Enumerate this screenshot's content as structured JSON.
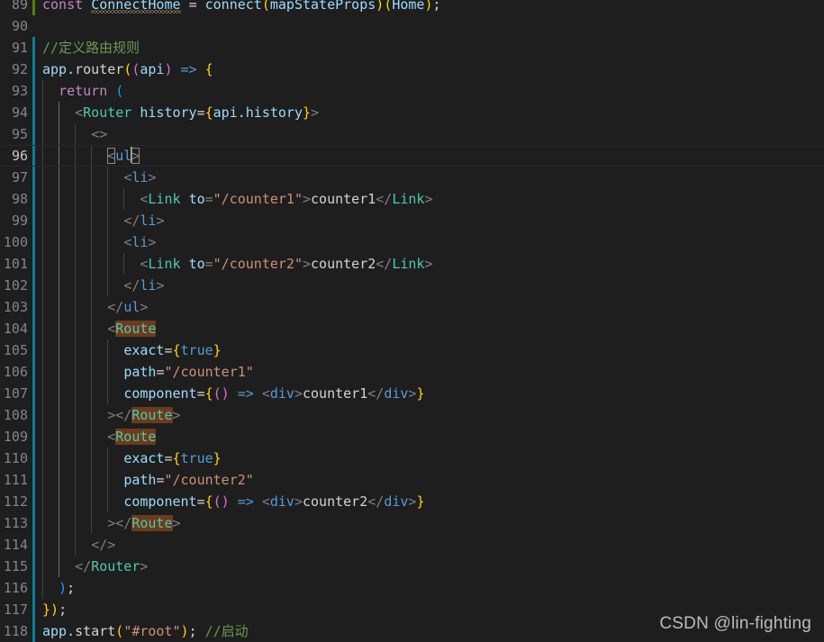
{
  "editor": {
    "theme": "dark-plus",
    "language": "javascript",
    "colors": {
      "background": "#1e1e1e",
      "foreground": "#d4d4d4",
      "line_number": "#858585",
      "line_number_active": "#c6c6c6",
      "comment": "#6a9955",
      "string": "#ce9178",
      "variable": "#9cdcfe",
      "component": "#4ec9b0",
      "tag": "#569cd6",
      "keyword": "#c586c0",
      "bracket_yellow": "#ffd700",
      "bracket_magenta": "#da70d6",
      "bracket_blue": "#179fff",
      "word_highlight": "#6c3b1c",
      "git_modified": "#0c7d9d",
      "git_added": "#587c0c",
      "indent_guide": "#404040",
      "indent_guide_active": "#707070",
      "caret": "#aeafad"
    },
    "active_line": 96,
    "first_visible_line": 89,
    "last_visible_line": 118
  },
  "watermark": {
    "text": "CSDN @lin-fighting"
  },
  "lines": [
    {
      "number": "89",
      "git": "add",
      "guides": 0,
      "clipped_top": true,
      "tokens": [
        {
          "text": "const ",
          "cls": "t-kw"
        },
        {
          "text": "ConnectHome",
          "cls": "t-var squig"
        },
        {
          "text": " ",
          "cls": "t-plain"
        },
        {
          "text": "=",
          "cls": "t-op"
        },
        {
          "text": " ",
          "cls": "t-plain"
        },
        {
          "text": "connect",
          "cls": "t-var"
        },
        {
          "text": "(",
          "cls": "t-punc1"
        },
        {
          "text": "mapStateProps",
          "cls": "t-var"
        },
        {
          "text": ")",
          "cls": "t-punc1"
        },
        {
          "text": "(",
          "cls": "t-punc1"
        },
        {
          "text": "Home",
          "cls": "t-var"
        },
        {
          "text": ")",
          "cls": "t-punc1"
        },
        {
          "text": ";",
          "cls": "t-plain"
        }
      ]
    },
    {
      "number": "90",
      "git": "none",
      "guides": 0,
      "tokens": []
    },
    {
      "number": "91",
      "git": "mod",
      "guides": 0,
      "tokens": [
        {
          "text": "//定义路由规则",
          "cls": "t-cmt"
        }
      ]
    },
    {
      "number": "92",
      "git": "mod",
      "guides": 0,
      "tokens": [
        {
          "text": "app",
          "cls": "t-var"
        },
        {
          "text": ".",
          "cls": "t-plain"
        },
        {
          "text": "router",
          "cls": "t-plain"
        },
        {
          "text": "(",
          "cls": "t-punc1"
        },
        {
          "text": "(",
          "cls": "t-punc2"
        },
        {
          "text": "api",
          "cls": "t-var"
        },
        {
          "text": ")",
          "cls": "t-punc2"
        },
        {
          "text": " ",
          "cls": "t-plain"
        },
        {
          "text": "=>",
          "cls": "t-arrow"
        },
        {
          "text": " ",
          "cls": "t-plain"
        },
        {
          "text": "{",
          "cls": "t-punc1"
        }
      ]
    },
    {
      "number": "93",
      "git": "mod",
      "guides": 1,
      "tokens": [
        {
          "text": "  ",
          "cls": "t-plain"
        },
        {
          "text": "return",
          "cls": "t-kw"
        },
        {
          "text": " ",
          "cls": "t-plain"
        },
        {
          "text": "(",
          "cls": "t-punc3"
        }
      ]
    },
    {
      "number": "94",
      "git": "mod",
      "guides": 2,
      "active_guide": 1,
      "tokens": [
        {
          "text": "    ",
          "cls": "t-plain"
        },
        {
          "text": "<",
          "cls": "t-tagbr"
        },
        {
          "text": "Router",
          "cls": "t-comp"
        },
        {
          "text": " ",
          "cls": "t-plain"
        },
        {
          "text": "history",
          "cls": "t-var"
        },
        {
          "text": "=",
          "cls": "t-plain"
        },
        {
          "text": "{",
          "cls": "t-punc1"
        },
        {
          "text": "api",
          "cls": "t-var"
        },
        {
          "text": ".",
          "cls": "t-plain"
        },
        {
          "text": "history",
          "cls": "t-var"
        },
        {
          "text": "}",
          "cls": "t-punc1"
        },
        {
          "text": ">",
          "cls": "t-tagbr"
        }
      ]
    },
    {
      "number": "95",
      "git": "mod",
      "guides": 3,
      "active_guide": 1,
      "tokens": [
        {
          "text": "      ",
          "cls": "t-plain"
        },
        {
          "text": "<>",
          "cls": "t-tagbr"
        }
      ]
    },
    {
      "number": "96",
      "git": "mod",
      "guides": 4,
      "active_guide": 1,
      "current": true,
      "tokens": [
        {
          "text": "        ",
          "cls": "t-plain"
        },
        {
          "text": "<",
          "cls": "t-tagbr bmatch"
        },
        {
          "text": "ul",
          "cls": "t-tag"
        },
        {
          "text": "|CARET|",
          "cls": "caret"
        },
        {
          "text": ">",
          "cls": "t-tagbr bmatch"
        }
      ]
    },
    {
      "number": "97",
      "git": "mod",
      "guides": 5,
      "active_guide": 1,
      "tokens": [
        {
          "text": "          ",
          "cls": "t-plain"
        },
        {
          "text": "<",
          "cls": "t-tagbr"
        },
        {
          "text": "li",
          "cls": "t-tag"
        },
        {
          "text": ">",
          "cls": "t-tagbr"
        }
      ]
    },
    {
      "number": "98",
      "git": "mod",
      "guides": 6,
      "active_guide": 1,
      "tokens": [
        {
          "text": "            ",
          "cls": "t-plain"
        },
        {
          "text": "<",
          "cls": "t-tagbr"
        },
        {
          "text": "Link",
          "cls": "t-comp"
        },
        {
          "text": " ",
          "cls": "t-plain"
        },
        {
          "text": "to",
          "cls": "t-var"
        },
        {
          "text": "=",
          "cls": "t-tagbr"
        },
        {
          "text": "\"/counter1\"",
          "cls": "t-str"
        },
        {
          "text": ">",
          "cls": "t-tagbr"
        },
        {
          "text": "counter1",
          "cls": "t-plain"
        },
        {
          "text": "</",
          "cls": "t-tagbr"
        },
        {
          "text": "Link",
          "cls": "t-comp"
        },
        {
          "text": ">",
          "cls": "t-tagbr"
        }
      ]
    },
    {
      "number": "99",
      "git": "mod",
      "guides": 5,
      "active_guide": 1,
      "tokens": [
        {
          "text": "          ",
          "cls": "t-plain"
        },
        {
          "text": "</",
          "cls": "t-tagbr"
        },
        {
          "text": "li",
          "cls": "t-tag"
        },
        {
          "text": ">",
          "cls": "t-tagbr"
        }
      ]
    },
    {
      "number": "100",
      "git": "mod",
      "guides": 5,
      "active_guide": 1,
      "tokens": [
        {
          "text": "          ",
          "cls": "t-plain"
        },
        {
          "text": "<",
          "cls": "t-tagbr"
        },
        {
          "text": "li",
          "cls": "t-tag"
        },
        {
          "text": ">",
          "cls": "t-tagbr"
        }
      ]
    },
    {
      "number": "101",
      "git": "mod",
      "guides": 6,
      "active_guide": 1,
      "tokens": [
        {
          "text": "            ",
          "cls": "t-plain"
        },
        {
          "text": "<",
          "cls": "t-tagbr"
        },
        {
          "text": "Link",
          "cls": "t-comp"
        },
        {
          "text": " ",
          "cls": "t-plain"
        },
        {
          "text": "to",
          "cls": "t-var"
        },
        {
          "text": "=",
          "cls": "t-tagbr"
        },
        {
          "text": "\"/counter2\"",
          "cls": "t-str"
        },
        {
          "text": ">",
          "cls": "t-tagbr"
        },
        {
          "text": "counter2",
          "cls": "t-plain"
        },
        {
          "text": "</",
          "cls": "t-tagbr"
        },
        {
          "text": "Link",
          "cls": "t-comp"
        },
        {
          "text": ">",
          "cls": "t-tagbr"
        }
      ]
    },
    {
      "number": "102",
      "git": "mod",
      "guides": 5,
      "active_guide": 1,
      "tokens": [
        {
          "text": "          ",
          "cls": "t-plain"
        },
        {
          "text": "</",
          "cls": "t-tagbr"
        },
        {
          "text": "li",
          "cls": "t-tag"
        },
        {
          "text": ">",
          "cls": "t-tagbr"
        }
      ]
    },
    {
      "number": "103",
      "git": "mod",
      "guides": 4,
      "active_guide": 1,
      "tokens": [
        {
          "text": "        ",
          "cls": "t-plain"
        },
        {
          "text": "</",
          "cls": "t-tagbr"
        },
        {
          "text": "ul",
          "cls": "t-tag"
        },
        {
          "text": ">",
          "cls": "t-tagbr"
        }
      ]
    },
    {
      "number": "104",
      "git": "mod",
      "guides": 4,
      "active_guide": 1,
      "tokens": [
        {
          "text": "        ",
          "cls": "t-plain"
        },
        {
          "text": "<",
          "cls": "t-tagbr"
        },
        {
          "text": "Route",
          "cls": "t-comp hl-word"
        }
      ]
    },
    {
      "number": "105",
      "git": "mod",
      "guides": 5,
      "active_guide": 1,
      "tokens": [
        {
          "text": "          ",
          "cls": "t-plain"
        },
        {
          "text": "exact",
          "cls": "t-var"
        },
        {
          "text": "=",
          "cls": "t-plain"
        },
        {
          "text": "{",
          "cls": "t-punc1"
        },
        {
          "text": "true",
          "cls": "t-bool"
        },
        {
          "text": "}",
          "cls": "t-punc1"
        }
      ]
    },
    {
      "number": "106",
      "git": "mod",
      "guides": 5,
      "active_guide": 1,
      "tokens": [
        {
          "text": "          ",
          "cls": "t-plain"
        },
        {
          "text": "path",
          "cls": "t-var"
        },
        {
          "text": "=",
          "cls": "t-plain"
        },
        {
          "text": "\"/counter1\"",
          "cls": "t-str"
        }
      ]
    },
    {
      "number": "107",
      "git": "mod",
      "guides": 5,
      "active_guide": 1,
      "tokens": [
        {
          "text": "          ",
          "cls": "t-plain"
        },
        {
          "text": "component",
          "cls": "t-var"
        },
        {
          "text": "=",
          "cls": "t-plain"
        },
        {
          "text": "{",
          "cls": "t-punc1"
        },
        {
          "text": "()",
          "cls": "t-punc2"
        },
        {
          "text": " ",
          "cls": "t-plain"
        },
        {
          "text": "=>",
          "cls": "t-arrow"
        },
        {
          "text": " ",
          "cls": "t-plain"
        },
        {
          "text": "<",
          "cls": "t-tagbr"
        },
        {
          "text": "div",
          "cls": "t-tag"
        },
        {
          "text": ">",
          "cls": "t-tagbr"
        },
        {
          "text": "counter1",
          "cls": "t-plain"
        },
        {
          "text": "</",
          "cls": "t-tagbr"
        },
        {
          "text": "div",
          "cls": "t-tag"
        },
        {
          "text": ">",
          "cls": "t-tagbr"
        },
        {
          "text": "}",
          "cls": "t-punc1"
        }
      ]
    },
    {
      "number": "108",
      "git": "mod",
      "guides": 4,
      "active_guide": 1,
      "tokens": [
        {
          "text": "        ",
          "cls": "t-plain"
        },
        {
          "text": ">",
          "cls": "t-tagbr"
        },
        {
          "text": "</",
          "cls": "t-tagbr"
        },
        {
          "text": "Route",
          "cls": "t-comp hl-word"
        },
        {
          "text": ">",
          "cls": "t-tagbr"
        }
      ]
    },
    {
      "number": "109",
      "git": "mod",
      "guides": 4,
      "active_guide": 1,
      "tokens": [
        {
          "text": "        ",
          "cls": "t-plain"
        },
        {
          "text": "<",
          "cls": "t-tagbr"
        },
        {
          "text": "Route",
          "cls": "t-comp hl-word"
        }
      ]
    },
    {
      "number": "110",
      "git": "mod",
      "guides": 5,
      "active_guide": 1,
      "tokens": [
        {
          "text": "          ",
          "cls": "t-plain"
        },
        {
          "text": "exact",
          "cls": "t-var"
        },
        {
          "text": "=",
          "cls": "t-plain"
        },
        {
          "text": "{",
          "cls": "t-punc1"
        },
        {
          "text": "true",
          "cls": "t-bool"
        },
        {
          "text": "}",
          "cls": "t-punc1"
        }
      ]
    },
    {
      "number": "111",
      "git": "mod",
      "guides": 5,
      "active_guide": 1,
      "tokens": [
        {
          "text": "          ",
          "cls": "t-plain"
        },
        {
          "text": "path",
          "cls": "t-var"
        },
        {
          "text": "=",
          "cls": "t-plain"
        },
        {
          "text": "\"/counter2\"",
          "cls": "t-str"
        }
      ]
    },
    {
      "number": "112",
      "git": "mod",
      "guides": 5,
      "active_guide": 1,
      "tokens": [
        {
          "text": "          ",
          "cls": "t-plain"
        },
        {
          "text": "component",
          "cls": "t-var"
        },
        {
          "text": "=",
          "cls": "t-plain"
        },
        {
          "text": "{",
          "cls": "t-punc1"
        },
        {
          "text": "()",
          "cls": "t-punc2"
        },
        {
          "text": " ",
          "cls": "t-plain"
        },
        {
          "text": "=>",
          "cls": "t-arrow"
        },
        {
          "text": " ",
          "cls": "t-plain"
        },
        {
          "text": "<",
          "cls": "t-tagbr"
        },
        {
          "text": "div",
          "cls": "t-tag"
        },
        {
          "text": ">",
          "cls": "t-tagbr"
        },
        {
          "text": "counter2",
          "cls": "t-plain"
        },
        {
          "text": "</",
          "cls": "t-tagbr"
        },
        {
          "text": "div",
          "cls": "t-tag"
        },
        {
          "text": ">",
          "cls": "t-tagbr"
        },
        {
          "text": "}",
          "cls": "t-punc1"
        }
      ]
    },
    {
      "number": "113",
      "git": "mod",
      "guides": 4,
      "active_guide": 1,
      "tokens": [
        {
          "text": "        ",
          "cls": "t-plain"
        },
        {
          "text": ">",
          "cls": "t-tagbr"
        },
        {
          "text": "</",
          "cls": "t-tagbr"
        },
        {
          "text": "Route",
          "cls": "t-comp hl-word"
        },
        {
          "text": ">",
          "cls": "t-tagbr"
        }
      ]
    },
    {
      "number": "114",
      "git": "mod",
      "guides": 3,
      "active_guide": 1,
      "tokens": [
        {
          "text": "      ",
          "cls": "t-plain"
        },
        {
          "text": "</>",
          "cls": "t-tagbr"
        }
      ]
    },
    {
      "number": "115",
      "git": "mod",
      "guides": 2,
      "active_guide": 1,
      "tokens": [
        {
          "text": "    ",
          "cls": "t-plain"
        },
        {
          "text": "</",
          "cls": "t-tagbr"
        },
        {
          "text": "Router",
          "cls": "t-comp"
        },
        {
          "text": ">",
          "cls": "t-tagbr"
        }
      ]
    },
    {
      "number": "116",
      "git": "mod",
      "guides": 1,
      "tokens": [
        {
          "text": "  ",
          "cls": "t-plain"
        },
        {
          "text": ")",
          "cls": "t-punc3"
        },
        {
          "text": ";",
          "cls": "t-plain"
        }
      ]
    },
    {
      "number": "117",
      "git": "mod",
      "guides": 0,
      "tokens": [
        {
          "text": "}",
          "cls": "t-punc1"
        },
        {
          "text": ")",
          "cls": "t-punc1"
        },
        {
          "text": ";",
          "cls": "t-plain"
        }
      ]
    },
    {
      "number": "118",
      "git": "mod",
      "guides": 0,
      "tokens": [
        {
          "text": "app",
          "cls": "t-var"
        },
        {
          "text": ".",
          "cls": "t-plain"
        },
        {
          "text": "start",
          "cls": "t-plain"
        },
        {
          "text": "(",
          "cls": "t-punc1"
        },
        {
          "text": "\"#root\"",
          "cls": "t-str"
        },
        {
          "text": ")",
          "cls": "t-punc1"
        },
        {
          "text": "; ",
          "cls": "t-plain"
        },
        {
          "text": "//启动",
          "cls": "t-cmt"
        }
      ]
    }
  ]
}
